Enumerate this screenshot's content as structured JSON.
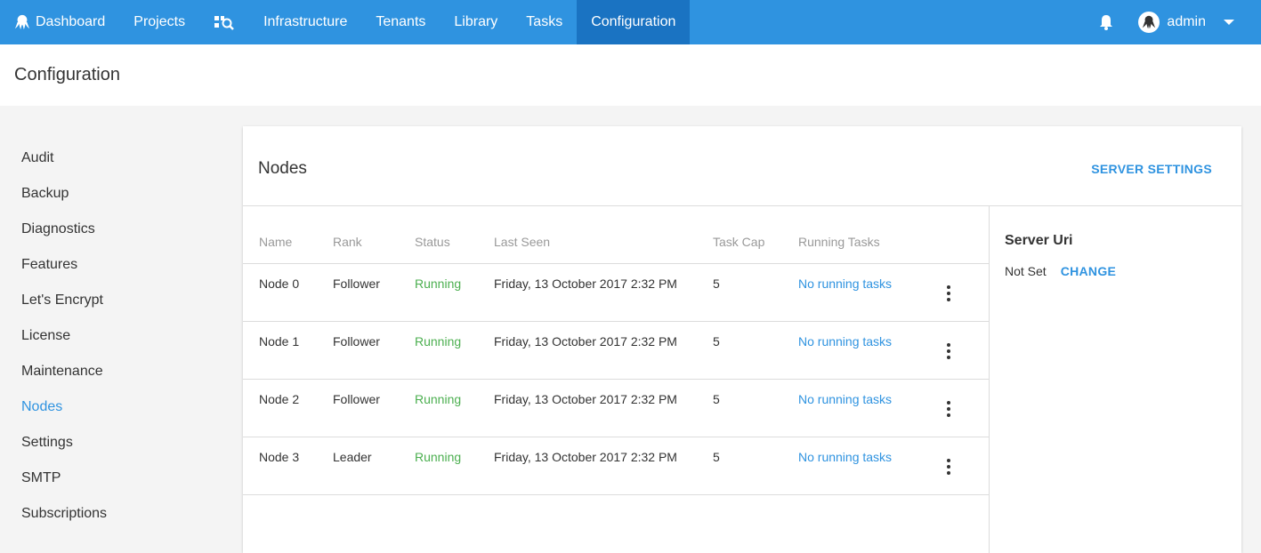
{
  "nav": {
    "items": [
      {
        "label": "Dashboard",
        "icon": "octopus-logo-icon"
      },
      {
        "label": "Projects"
      },
      {
        "label": "",
        "icon": "project-search-icon"
      },
      {
        "label": "Infrastructure"
      },
      {
        "label": "Tenants"
      },
      {
        "label": "Library"
      },
      {
        "label": "Tasks"
      },
      {
        "label": "Configuration",
        "active": true
      }
    ],
    "user": "admin",
    "accent": "#2f93e0",
    "active_bg": "#1a73c2"
  },
  "page": {
    "title": "Configuration"
  },
  "sidebar": {
    "items": [
      {
        "label": "Audit"
      },
      {
        "label": "Backup"
      },
      {
        "label": "Diagnostics"
      },
      {
        "label": "Features"
      },
      {
        "label": "Let's Encrypt"
      },
      {
        "label": "License"
      },
      {
        "label": "Maintenance"
      },
      {
        "label": "Nodes",
        "active": true
      },
      {
        "label": "Settings"
      },
      {
        "label": "SMTP"
      },
      {
        "label": "Subscriptions"
      }
    ]
  },
  "panel": {
    "title": "Nodes",
    "action": "SERVER SETTINGS",
    "columns": [
      "Name",
      "Rank",
      "Status",
      "Last Seen",
      "Task Cap",
      "Running Tasks"
    ],
    "rows": [
      {
        "name": "Node 0",
        "rank": "Follower",
        "status": "Running",
        "last_seen": "Friday, 13 October 2017 2:32 PM",
        "task_cap": "5",
        "running_tasks": "No running tasks"
      },
      {
        "name": "Node 1",
        "rank": "Follower",
        "status": "Running",
        "last_seen": "Friday, 13 October 2017 2:32 PM",
        "task_cap": "5",
        "running_tasks": "No running tasks"
      },
      {
        "name": "Node 2",
        "rank": "Follower",
        "status": "Running",
        "last_seen": "Friday, 13 October 2017 2:32 PM",
        "task_cap": "5",
        "running_tasks": "No running tasks"
      },
      {
        "name": "Node 3",
        "rank": "Leader",
        "status": "Running",
        "last_seen": "Friday, 13 October 2017 2:32 PM",
        "task_cap": "5",
        "running_tasks": "No running tasks"
      }
    ],
    "server_uri": {
      "title": "Server Uri",
      "value": "Not Set",
      "action": "CHANGE"
    },
    "status_color": "#4caf50"
  }
}
